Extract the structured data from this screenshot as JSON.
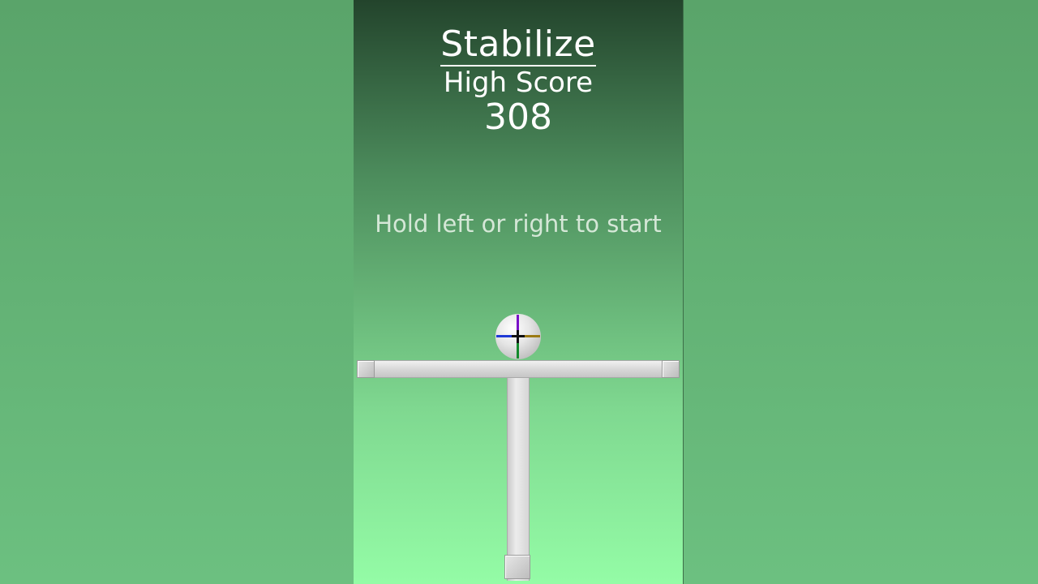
{
  "game": {
    "title": "Stabilize",
    "high_score_label": "High Score",
    "high_score_value": "308",
    "instruction": "Hold left or right to start"
  },
  "colors": {
    "background": "#5aa46a",
    "panel_top": "#23442c",
    "panel_bottom": "#94fca6",
    "platform": "#d8d8d8",
    "ball": "#e6e6e6"
  },
  "icons": {
    "ball_marker": "crosshair-icon"
  }
}
